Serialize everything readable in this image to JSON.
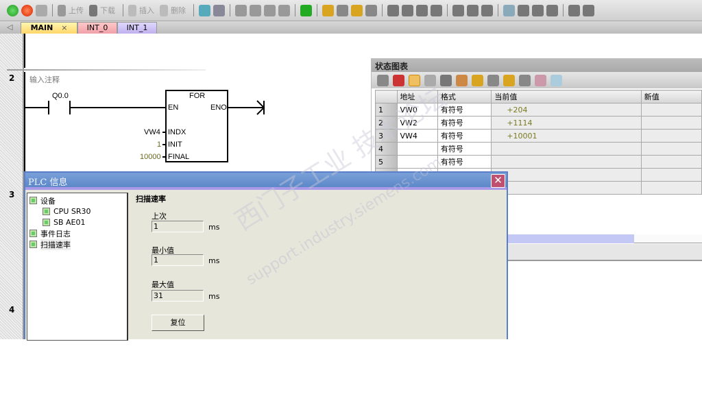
{
  "toolbar": {
    "upload": "上传",
    "download": "下载",
    "insert": "插入",
    "delete": "删除"
  },
  "tabs": [
    {
      "label": "MAIN",
      "close": "×"
    },
    {
      "label": "INT_0"
    },
    {
      "label": "INT_1"
    }
  ],
  "networks": [
    {
      "num": "2",
      "comment": "输入注释"
    },
    {
      "num": "3"
    },
    {
      "num": "4"
    }
  ],
  "ladder": {
    "contact": "Q0.0",
    "box_title": "FOR",
    "en": "EN",
    "eno": "ENO",
    "indx": "INDX",
    "init": "INIT",
    "final": "FINAL",
    "indx_val": "VW4",
    "init_val": "1",
    "final_val": "10000"
  },
  "status_chart": {
    "title": "状态图表",
    "headers": [
      "地址",
      "格式",
      "当前值",
      "新值"
    ],
    "rows": [
      [
        "1",
        "VW0",
        "有符号",
        "+204",
        ""
      ],
      [
        "2",
        "VW2",
        "有符号",
        "+1114",
        ""
      ],
      [
        "3",
        "VW4",
        "有符号",
        "+10001",
        ""
      ],
      [
        "4",
        "",
        "有符号",
        "",
        ""
      ],
      [
        "5",
        "",
        "有符号",
        "",
        ""
      ]
    ]
  },
  "dialog": {
    "title": "PLC 信息",
    "close": "✕",
    "tree": [
      {
        "label": "设备"
      },
      {
        "label": "CPU SR30"
      },
      {
        "label": "SB AE01"
      },
      {
        "label": "事件日志"
      },
      {
        "label": "扫描速率"
      }
    ],
    "section": "扫描速率",
    "last_label": "上次",
    "last": "1",
    "min_label": "最小值",
    "min": "1",
    "max_label": "最大值",
    "max": "31",
    "unit": "ms",
    "reset": "复位"
  },
  "watermark": {
    "line1": "西门子工业 技术论坛",
    "line2": "support.industry.siemens.com"
  }
}
